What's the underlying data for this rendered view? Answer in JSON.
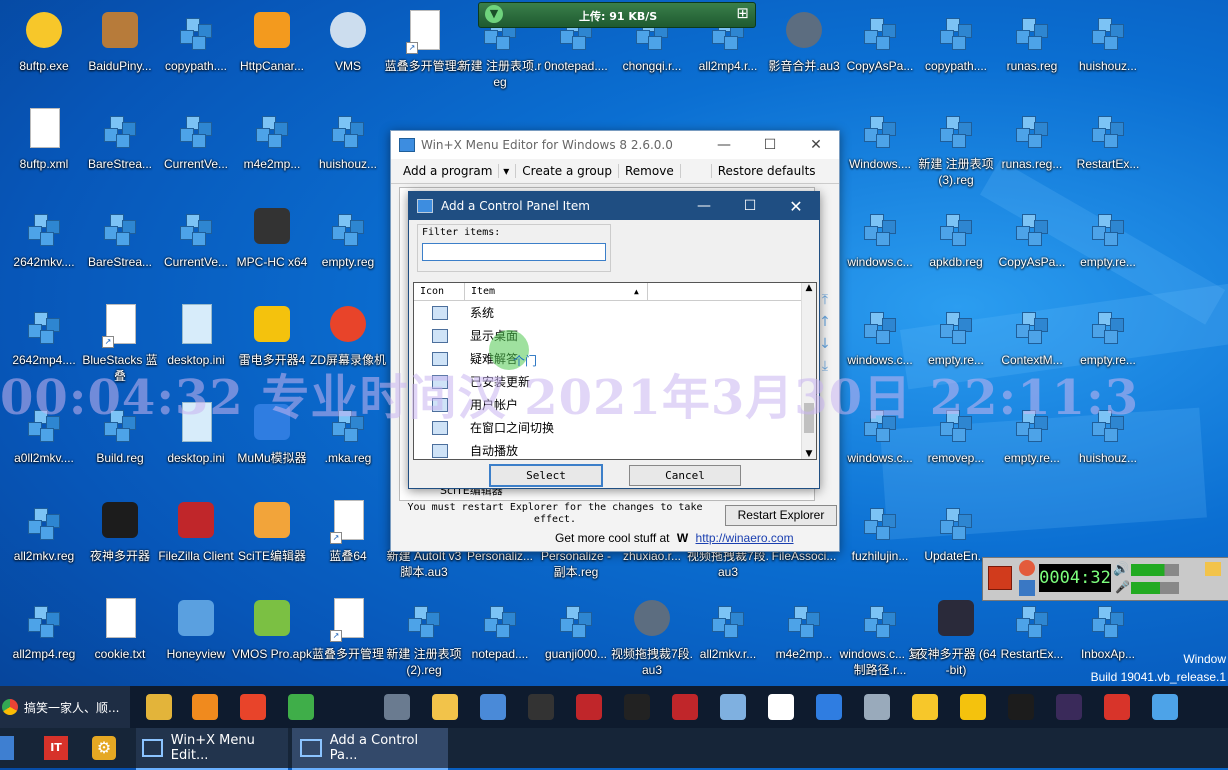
{
  "desktop_icons": [
    {
      "label": "8uftp.exe",
      "icon": "ftp-smiley-icon"
    },
    {
      "label": "BaiduPiny...",
      "icon": "box-icon"
    },
    {
      "label": "copypath....",
      "icon": "registry-cube-icon"
    },
    {
      "label": "HttpCanar...",
      "icon": "orange-bird-icon"
    },
    {
      "label": "VMS",
      "icon": "camera-icon"
    },
    {
      "label": "蓝叠多开管理2",
      "icon": "blank-file-icon"
    },
    {
      "label": "新建 注册表项.reg",
      "icon": "registry-cube-icon"
    },
    {
      "label": "0notepad....",
      "icon": "registry-cube-icon"
    },
    {
      "label": "chongqi.r...",
      "icon": "registry-cube-icon"
    },
    {
      "label": "all2mp4.r...",
      "icon": "registry-cube-icon"
    },
    {
      "label": "影音合并.au3",
      "icon": "autoit-icon"
    },
    {
      "label": "CopyAsPa...",
      "icon": "registry-cube-icon"
    },
    {
      "label": "copypath....",
      "icon": "registry-cube-icon"
    },
    {
      "label": "runas.reg",
      "icon": "registry-cube-icon"
    },
    {
      "label": "huishouz...",
      "icon": "registry-cube-icon"
    },
    {
      "label": "8uftp.xml",
      "icon": "xml-file-icon"
    },
    {
      "label": "BareStrea...",
      "icon": "registry-cube-icon"
    },
    {
      "label": "CurrentVe...",
      "icon": "registry-cube-icon"
    },
    {
      "label": "m4e2mp...",
      "icon": "registry-cube-icon"
    },
    {
      "label": "huishouz...",
      "icon": "registry-cube-icon"
    },
    {
      "label": "Windows....",
      "icon": "registry-cube-icon"
    },
    {
      "label": "新建 注册表项 (3).reg",
      "icon": "registry-cube-icon"
    },
    {
      "label": "runas.reg...",
      "icon": "registry-cube-icon"
    },
    {
      "label": "RestartEx...",
      "icon": "registry-cube-icon"
    },
    {
      "label": "2642mkv....",
      "icon": "registry-cube-icon"
    },
    {
      "label": "BareStrea...",
      "icon": "registry-cube-icon"
    },
    {
      "label": "CurrentVe...",
      "icon": "registry-cube-icon"
    },
    {
      "label": "MPC-HC x64",
      "icon": "mpc-icon"
    },
    {
      "label": "empty.reg",
      "icon": "registry-cube-icon"
    },
    {
      "label": "windows.c...",
      "icon": "registry-cube-icon"
    },
    {
      "label": "apkdb.reg",
      "icon": "registry-cube-icon"
    },
    {
      "label": "CopyAsPa...",
      "icon": "registry-cube-icon"
    },
    {
      "label": "empty.re...",
      "icon": "registry-cube-icon"
    },
    {
      "label": "2642mp4....",
      "icon": "registry-cube-icon"
    },
    {
      "label": "BlueStacks 蓝叠",
      "icon": "blank-file-icon"
    },
    {
      "label": "desktop.ini",
      "icon": "settings-file-icon"
    },
    {
      "label": "雷电多开器4",
      "icon": "ldplayer-icon"
    },
    {
      "label": "ZD屏幕录像机",
      "icon": "record-icon"
    },
    {
      "label": "windows.c...",
      "icon": "registry-cube-icon"
    },
    {
      "label": "empty.re...",
      "icon": "registry-cube-icon"
    },
    {
      "label": "ContextM...",
      "icon": "registry-cube-icon"
    },
    {
      "label": "empty.re...",
      "icon": "registry-cube-icon"
    },
    {
      "label": "a0ll2mkv....",
      "icon": "registry-cube-icon"
    },
    {
      "label": "Build.reg",
      "icon": "registry-cube-icon"
    },
    {
      "label": "desktop.ini",
      "icon": "settings-file-icon"
    },
    {
      "label": "MuMu模拟器",
      "icon": "mumu-icon"
    },
    {
      "label": ".mka.reg",
      "icon": "registry-cube-icon"
    },
    {
      "label": "windows.c...",
      "icon": "registry-cube-icon"
    },
    {
      "label": "removep...",
      "icon": "registry-cube-icon"
    },
    {
      "label": "empty.re...",
      "icon": "registry-cube-icon"
    },
    {
      "label": "huishouz...",
      "icon": "registry-cube-icon"
    },
    {
      "label": "all2mkv.reg",
      "icon": "registry-cube-icon"
    },
    {
      "label": "夜神多开器",
      "icon": "nox-icon"
    },
    {
      "label": "FileZilla Client",
      "icon": "filezilla-icon"
    },
    {
      "label": "SciTE编辑器",
      "icon": "scite-icon"
    },
    {
      "label": "蓝叠64",
      "icon": "blank-file-icon"
    },
    {
      "label": "新建 AutoIt v3 脚本.au3",
      "icon": "registry-cube-icon"
    },
    {
      "label": "Personaliz...",
      "icon": "registry-cube-icon"
    },
    {
      "label": "Personalize - 副本.reg",
      "icon": "registry-cube-icon"
    },
    {
      "label": "zhuxiao.r...",
      "icon": "registry-cube-icon"
    },
    {
      "label": "视频拖拽裁7段.au3",
      "icon": "registry-cube-icon"
    },
    {
      "label": "FileAssoci...",
      "icon": "registry-cube-icon"
    },
    {
      "label": "fuzhilujin...",
      "icon": "registry-cube-icon"
    },
    {
      "label": "UpdateEn...",
      "icon": "registry-cube-icon"
    },
    {
      "label": "all2mp4.reg",
      "icon": "registry-cube-icon"
    },
    {
      "label": "cookie.txt",
      "icon": "text-file-icon"
    },
    {
      "label": "Honeyview",
      "icon": "honeyview-icon"
    },
    {
      "label": "VMOS Pro.apk",
      "icon": "android-icon"
    },
    {
      "label": "蓝叠多开管理",
      "icon": "blank-file-icon"
    },
    {
      "label": "新建 注册表项 (2).reg",
      "icon": "registry-cube-icon"
    },
    {
      "label": "notepad....",
      "icon": "registry-cube-icon"
    },
    {
      "label": "guanji000...",
      "icon": "registry-cube-icon"
    },
    {
      "label": "视频拖拽裁7段.au3",
      "icon": "autoit-icon"
    },
    {
      "label": "all2mkv.r...",
      "icon": "registry-cube-icon"
    },
    {
      "label": "m4e2mp...",
      "icon": "registry-cube-icon"
    },
    {
      "label": "windows.c... 复制路径.r...",
      "icon": "registry-cube-icon"
    },
    {
      "label": "夜神多开器 (64-bit)",
      "icon": "nox64-icon"
    },
    {
      "label": "RestartEx...",
      "icon": "registry-cube-icon"
    },
    {
      "label": "InboxAp...",
      "icon": "registry-cube-icon"
    }
  ],
  "ftp_bar": {
    "upload": "上传: 91 KB/S"
  },
  "winx_window": {
    "title": "Win+X Menu Editor for Windows 8 2.6.0.0",
    "menu": {
      "add_program": "Add a program",
      "create_group": "Create a group",
      "remove": "Remove",
      "restore": "Restore defaults"
    },
    "notice": "You must restart Explorer for the changes to take effect.",
    "restart_button": "Restart Explorer",
    "cool_text": "Get more cool stuff at",
    "winaero_link": "http://winaero.com",
    "behind_item": "SciTE编辑器"
  },
  "dialog": {
    "title": "Add a Control Panel Item",
    "filter_label": "Filter items:",
    "filter_value": "",
    "col_icon": "Icon",
    "col_item": "Item",
    "items": [
      "系统",
      "显示桌面",
      "疑难解答",
      "已安装更新",
      "用户帐户",
      "在窗口之间切换",
      "自动播放"
    ],
    "select_button": "Select",
    "cancel_button": "Cancel",
    "tooltip": "个门"
  },
  "watermark": "00:04:32 专业时间汉 2021年3月30日 22:11:3",
  "recorder": {
    "time": "0004:32"
  },
  "windows_build": {
    "line1": "Window",
    "line2": "Build 19041.vb_release.1"
  },
  "taskbar_top": {
    "browser_tab": "搞笑一家人、顺..."
  },
  "taskbar_bottom": {
    "task1": "Win+X Menu Edit...",
    "task2": "Add a Control Pa..."
  },
  "colors": {
    "desktop": "#0b6fd2",
    "taskbar": "#0e1b2e",
    "dialog_title": "#1f4e82",
    "select_border": "#3c7fc9"
  }
}
